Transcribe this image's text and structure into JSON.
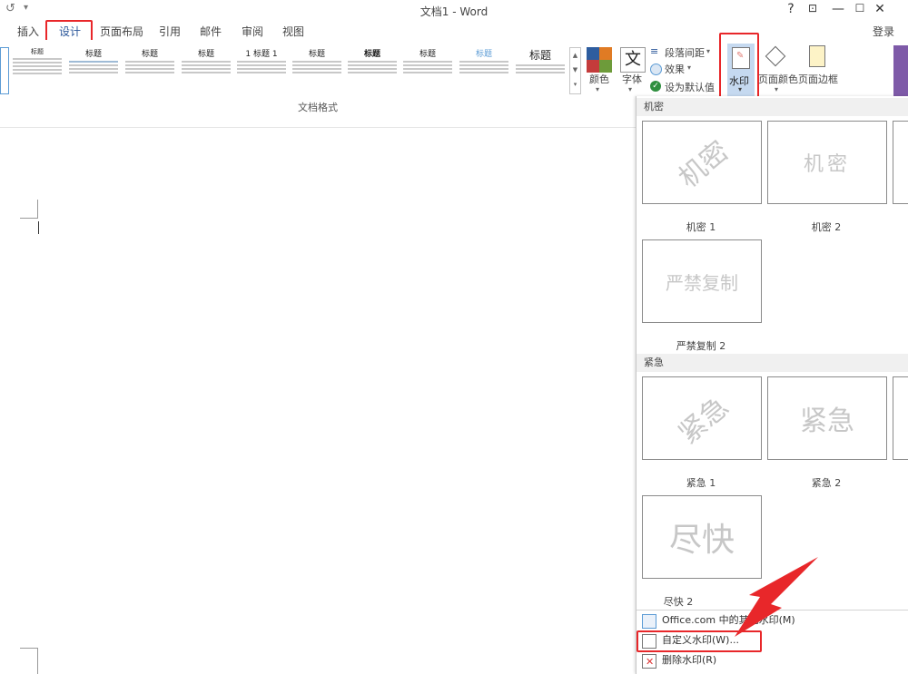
{
  "window": {
    "title": "文档1 - Word",
    "help": "?",
    "signin": "登录"
  },
  "tabs": [
    {
      "label": "插入"
    },
    {
      "label": "设计"
    },
    {
      "label": "页面布局"
    },
    {
      "label": "引用"
    },
    {
      "label": "邮件"
    },
    {
      "label": "审阅"
    },
    {
      "label": "视图"
    }
  ],
  "ribbon": {
    "style_titles": [
      "标题",
      "标题",
      "标题",
      "标题",
      "1 标题 1",
      "标题",
      "标题",
      "标题",
      "标题",
      "标题"
    ],
    "group_label": "文档格式",
    "colors_label": "颜色",
    "fonts_label": "字体",
    "fonts_glyph": "文",
    "paragraph_spacing": "段落间距",
    "effects": "效果",
    "set_default": "设为默认值",
    "watermark": "水印",
    "page_color": "页面颜色",
    "page_borders": "页面边框"
  },
  "panel": {
    "sections": [
      {
        "name": "机密"
      },
      {
        "name": "紧急"
      }
    ],
    "watermarks": [
      {
        "text": "机密",
        "caption": "机密 1"
      },
      {
        "text": "机密",
        "caption": "机密 2"
      },
      {
        "text": "严禁复制",
        "caption": "严禁复制 2"
      },
      {
        "text": "紧急",
        "caption": "紧急 1"
      },
      {
        "text": "紧急",
        "caption": "紧急 2"
      },
      {
        "text": "尽快",
        "caption": "尽快 2"
      }
    ],
    "menu": [
      {
        "label": "Office.com 中的其他水印(M)"
      },
      {
        "label": "自定义水印(W)..."
      },
      {
        "label": "删除水印(R)"
      }
    ]
  },
  "colors": {
    "accent": "#2b579a",
    "highlight": "#e8272a"
  }
}
